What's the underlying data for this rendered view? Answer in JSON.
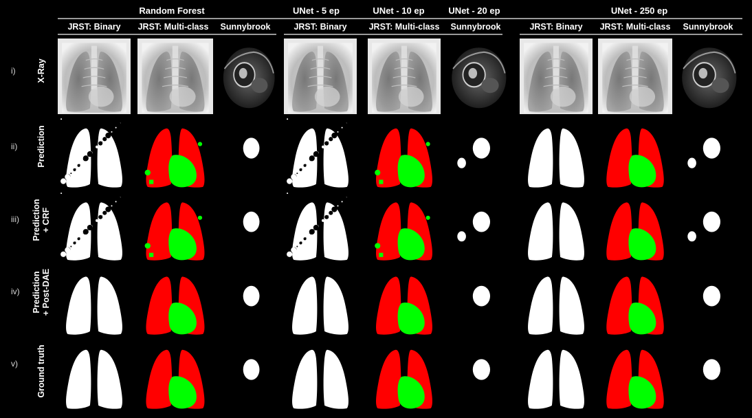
{
  "groups": [
    {
      "title": "Random Forest"
    },
    {
      "title": "UNet - 5 ep"
    },
    {
      "title": "UNet - 10 ep"
    },
    {
      "title": "UNet - 20 ep"
    },
    {
      "title": "UNet - 250 ep"
    }
  ],
  "columns": [
    {
      "label": "JRST: Binary"
    },
    {
      "label": "JRST: Multi-class"
    },
    {
      "label": "Sunnybrook"
    },
    {
      "label": "JRST: Binary"
    },
    {
      "label": "JRST: Multi-class"
    },
    {
      "label": "Sunnybrook"
    },
    {
      "label": "JRST: Binary"
    },
    {
      "label": "JRST: Multi-class"
    },
    {
      "label": "Sunnybrook"
    }
  ],
  "rows": [
    {
      "num": "i)",
      "label": "X-Ray",
      "label2": ""
    },
    {
      "num": "ii)",
      "label": "Prediction",
      "label2": ""
    },
    {
      "num": "iii)",
      "label": "Prediction",
      "label2": "+ CRF"
    },
    {
      "num": "iv)",
      "label": "Prediction",
      "label2": "+ Post-DAE"
    },
    {
      "num": "v)",
      "label": "Ground truth",
      "label2": ""
    }
  ],
  "colors": {
    "background": "#000000",
    "lung_left_class": "#ff0000",
    "heart_class": "#00ff00",
    "binary_mask": "#ffffff",
    "header_rule": "#9a9a9a"
  }
}
